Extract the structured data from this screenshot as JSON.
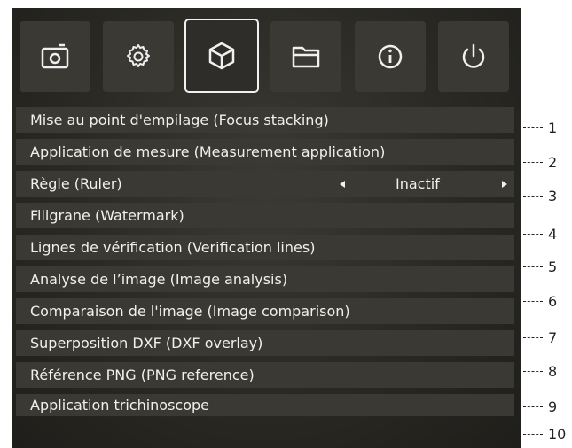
{
  "toolbar": {
    "icons": [
      "camera-icon",
      "gear-icon",
      "cube-icon",
      "folder-icon",
      "info-icon",
      "power-icon"
    ],
    "active": "cube-icon"
  },
  "menu": {
    "items": [
      {
        "label": "Mise au point d'empilage (Focus stacking)"
      },
      {
        "label": "Application de mesure (Measurement application)"
      },
      {
        "label": "Règle (Ruler)",
        "value": "Inactif"
      },
      {
        "label": "Filigrane (Watermark)"
      },
      {
        "label": "Lignes de vérification (Verification lines)"
      },
      {
        "label": "Analyse de l’image (Image analysis)"
      },
      {
        "label": "Comparaison de l'image (Image comparison)"
      },
      {
        "label": "Superposition DXF (DXF overlay)"
      },
      {
        "label": "Référence PNG (PNG reference)"
      },
      {
        "label": "Application trichinoscope"
      }
    ]
  },
  "callouts": [
    "1",
    "2",
    "3",
    "4",
    "5",
    "6",
    "7",
    "8",
    "9",
    "10"
  ],
  "colors": {
    "panel": "#2a2924",
    "button": "#3a3934",
    "text": "#f0f0f0",
    "active_border": "#f1f1f1"
  }
}
